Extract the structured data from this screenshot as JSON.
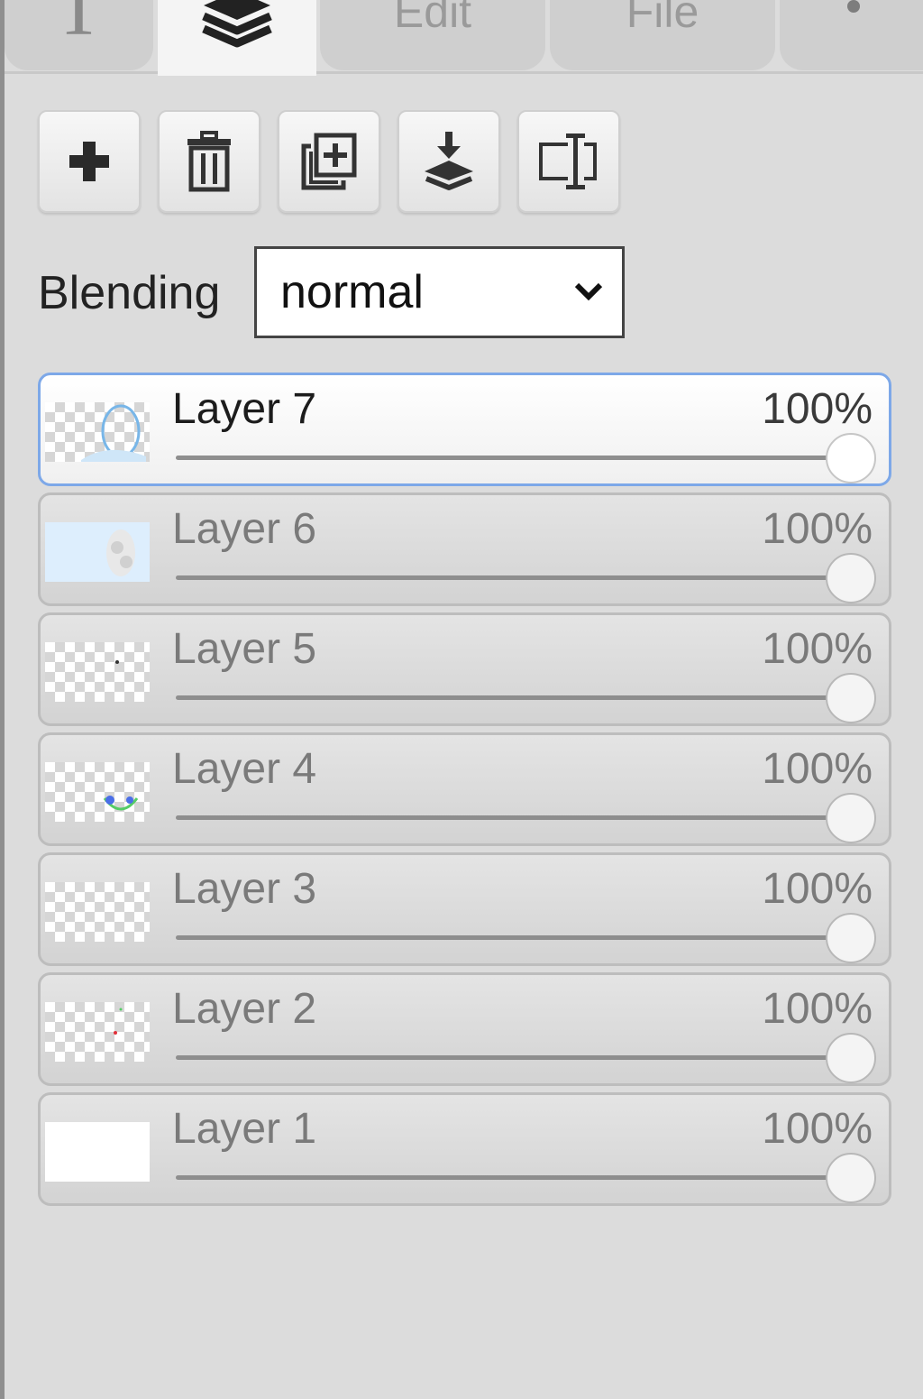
{
  "tabs": {
    "text_glyph": "T",
    "edit_label": "Edit",
    "file_label": "File"
  },
  "toolbar": {
    "buttons": [
      "add-layer",
      "delete-layer",
      "duplicate-layer",
      "merge-down",
      "rename-layer"
    ]
  },
  "blending": {
    "label": "Blending",
    "value": "normal"
  },
  "layers": [
    {
      "name": "Layer 7",
      "opacity_label": "100%",
      "opacity": 1.0,
      "active": true
    },
    {
      "name": "Layer 6",
      "opacity_label": "100%",
      "opacity": 1.0,
      "active": false
    },
    {
      "name": "Layer 5",
      "opacity_label": "100%",
      "opacity": 1.0,
      "active": false
    },
    {
      "name": "Layer 4",
      "opacity_label": "100%",
      "opacity": 1.0,
      "active": false
    },
    {
      "name": "Layer 3",
      "opacity_label": "100%",
      "opacity": 1.0,
      "active": false
    },
    {
      "name": "Layer 2",
      "opacity_label": "100%",
      "opacity": 1.0,
      "active": false
    },
    {
      "name": "Layer 1",
      "opacity_label": "100%",
      "opacity": 1.0,
      "active": false
    }
  ],
  "colors": {
    "active_border": "#7da8e8",
    "panel_bg": "#dcdcdc"
  }
}
